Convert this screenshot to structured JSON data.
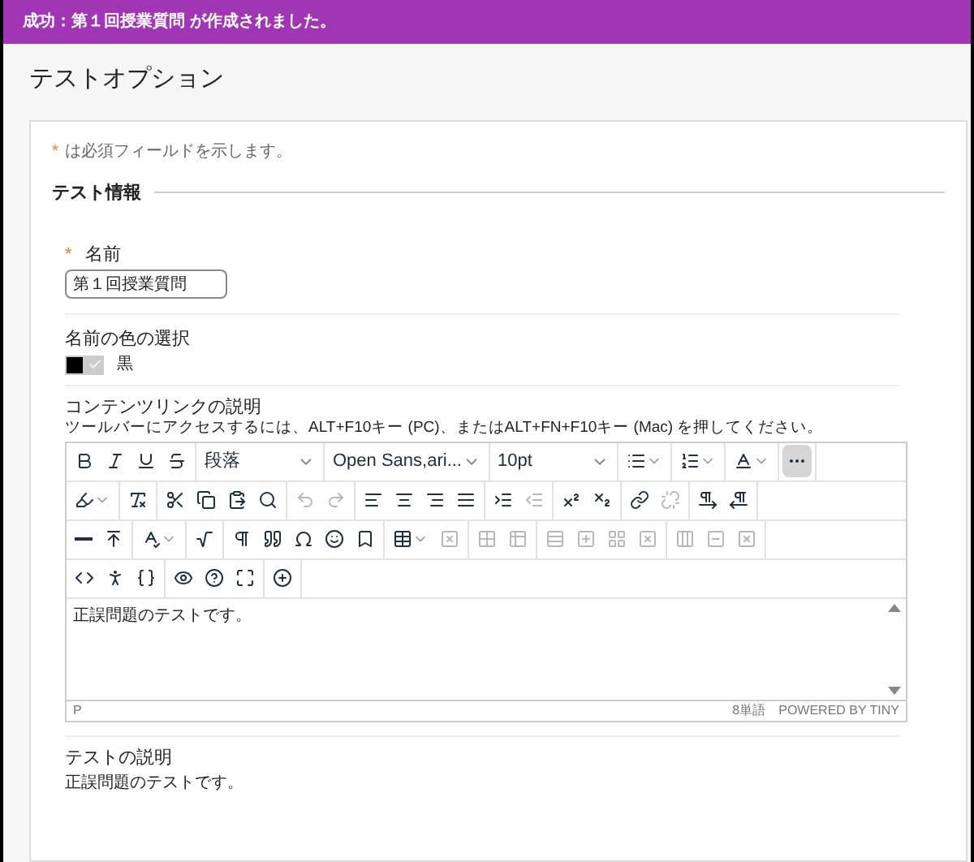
{
  "banner": {
    "text": "成功：第１回授業質問 が作成されました。"
  },
  "page_title": "テストオプション",
  "required_note": {
    "mark": "*",
    "text": "は必須フィールドを示します。"
  },
  "section": {
    "title": "テスト情報"
  },
  "name_field": {
    "required_mark": "*",
    "label": "名前",
    "value": "第１回授業質問"
  },
  "name_color": {
    "label": "名前の色の選択",
    "color": "#000000",
    "selected": true,
    "value": "黒"
  },
  "content_link": {
    "label": "コンテンツリンクの説明",
    "hint": "ツールバーにアクセスするには、ALT+F10キー (PC)、またはALT+FN+F10キー (Mac) を押してください。"
  },
  "editor": {
    "toolbar": [
      [
        [
          {
            "kind": "bold",
            "disabled": false,
            "pressed": false
          },
          {
            "kind": "italic",
            "disabled": false,
            "pressed": false
          },
          {
            "kind": "underline",
            "disabled": false,
            "pressed": false
          },
          {
            "kind": "strikethrough",
            "disabled": false,
            "pressed": false
          }
        ],
        [
          {
            "kind": "select",
            "value": "段落",
            "disabled": false,
            "pressed": false
          }
        ],
        [
          {
            "kind": "select",
            "value": "Open Sans,ari...",
            "disabled": false,
            "pressed": false
          }
        ],
        [
          {
            "kind": "select",
            "value": "10pt",
            "disabled": false,
            "pressed": false
          }
        ],
        [
          {
            "kind": "bullet-list",
            "menu": true,
            "disabled": false,
            "pressed": false
          }
        ],
        [
          {
            "kind": "numbered-list",
            "menu": true,
            "disabled": false,
            "pressed": false
          }
        ],
        [
          {
            "kind": "text-color",
            "menu": true,
            "disabled": false,
            "pressed": false
          }
        ],
        [
          {
            "kind": "more",
            "disabled": false,
            "pressed": true
          }
        ]
      ],
      [
        [
          {
            "kind": "highlight",
            "menu": true,
            "disabled": false,
            "pressed": false
          }
        ],
        [
          {
            "kind": "clear-format",
            "disabled": false,
            "pressed": false
          }
        ],
        [
          {
            "kind": "cut",
            "disabled": false,
            "pressed": false
          },
          {
            "kind": "copy",
            "disabled": false,
            "pressed": false
          },
          {
            "kind": "paste",
            "disabled": false,
            "pressed": false
          },
          {
            "kind": "search",
            "disabled": false,
            "pressed": false
          }
        ],
        [
          {
            "kind": "undo",
            "disabled": true,
            "pressed": false
          },
          {
            "kind": "redo",
            "disabled": true,
            "pressed": false
          }
        ],
        [
          {
            "kind": "align-left",
            "disabled": false,
            "pressed": false
          },
          {
            "kind": "align-center",
            "disabled": false,
            "pressed": false
          },
          {
            "kind": "align-right",
            "disabled": false,
            "pressed": false
          },
          {
            "kind": "justify",
            "disabled": false,
            "pressed": false
          }
        ],
        [
          {
            "kind": "indent",
            "disabled": false,
            "pressed": false
          },
          {
            "kind": "outdent",
            "disabled": true,
            "pressed": false
          }
        ],
        [
          {
            "kind": "superscript",
            "disabled": false,
            "pressed": false
          },
          {
            "kind": "subscript",
            "disabled": false,
            "pressed": false
          }
        ],
        [
          {
            "kind": "link",
            "disabled": false,
            "pressed": false
          },
          {
            "kind": "unlink",
            "disabled": true,
            "pressed": false
          }
        ],
        [
          {
            "kind": "ltr",
            "disabled": false,
            "pressed": false
          },
          {
            "kind": "rtl",
            "disabled": false,
            "pressed": false
          }
        ]
      ],
      [
        [
          {
            "kind": "rule",
            "disabled": false,
            "pressed": false
          },
          {
            "kind": "insert",
            "disabled": false,
            "pressed": false
          }
        ],
        [
          {
            "kind": "spellcheck",
            "menu": true,
            "disabled": false,
            "pressed": false
          }
        ],
        [
          {
            "kind": "math",
            "disabled": false,
            "pressed": false
          }
        ],
        [
          {
            "kind": "pilcrow",
            "disabled": false,
            "pressed": false
          },
          {
            "kind": "quote",
            "disabled": false,
            "pressed": false
          },
          {
            "kind": "omega",
            "disabled": false,
            "pressed": false
          },
          {
            "kind": "emoji",
            "disabled": false,
            "pressed": false
          },
          {
            "kind": "bookmark",
            "disabled": false,
            "pressed": false
          }
        ],
        [
          {
            "kind": "table",
            "menu": true,
            "disabled": false,
            "pressed": false
          },
          {
            "kind": "table-delete",
            "disabled": true,
            "pressed": false
          }
        ],
        [
          {
            "kind": "table-cell",
            "disabled": true,
            "pressed": false
          },
          {
            "kind": "table-merge",
            "disabled": true,
            "pressed": false
          }
        ],
        [
          {
            "kind": "row-before",
            "disabled": true,
            "pressed": false
          },
          {
            "kind": "row-after",
            "disabled": true,
            "pressed": false
          },
          {
            "kind": "row-insert",
            "disabled": true,
            "pressed": false
          },
          {
            "kind": "row-delete",
            "disabled": true,
            "pressed": false
          }
        ],
        [
          {
            "kind": "col-before",
            "disabled": true,
            "pressed": false
          },
          {
            "kind": "col-after",
            "disabled": true,
            "pressed": false
          },
          {
            "kind": "col-delete",
            "disabled": true,
            "pressed": false
          }
        ]
      ],
      [
        [
          {
            "kind": "code",
            "disabled": false,
            "pressed": false
          },
          {
            "kind": "accessibility",
            "disabled": false,
            "pressed": false
          },
          {
            "kind": "braces",
            "disabled": false,
            "pressed": false
          }
        ],
        [
          {
            "kind": "preview",
            "disabled": false,
            "pressed": false
          },
          {
            "kind": "help",
            "disabled": false,
            "pressed": false
          },
          {
            "kind": "fullscreen",
            "disabled": false,
            "pressed": false
          }
        ],
        [
          {
            "kind": "add",
            "disabled": false,
            "pressed": false
          }
        ]
      ]
    ],
    "content": "正誤問題のテストです。",
    "path": "P",
    "word_count": "8単語",
    "branding": "POWERED BY TINY"
  },
  "description": {
    "label": "テストの説明",
    "text": "正誤問題のテストです。"
  }
}
